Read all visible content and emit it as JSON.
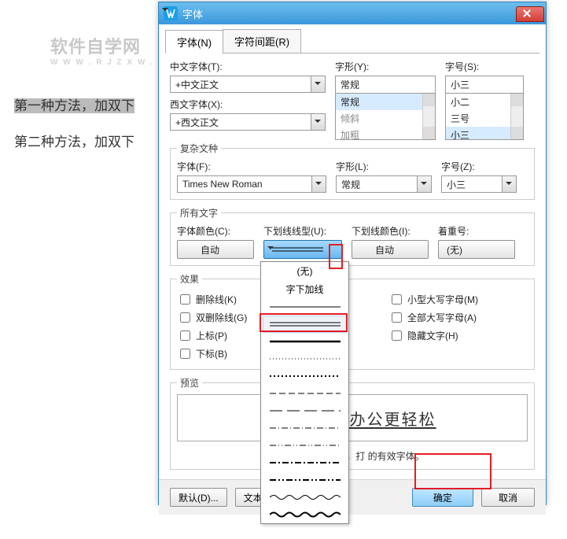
{
  "watermark": {
    "main": "软件自学网",
    "sub": "W W W . R J Z X W . C O M"
  },
  "bg": {
    "l1": "第一种方法，加双下",
    "l2": "第二种方法，加双下"
  },
  "dialog": {
    "title": "字体",
    "tabs": {
      "font": "字体(N)",
      "spacing": "字符间距(R)"
    },
    "cnFontLabel": "中文字体(T):",
    "cnFont": "+中文正文",
    "styleLabel": "字形(Y):",
    "style": "常规",
    "styles": {
      "a": "常规",
      "b": "倾斜",
      "c": "加粗"
    },
    "sizeLabel": "字号(S):",
    "size": "小三",
    "sizes": {
      "a": "小二",
      "b": "三号",
      "c": "小三"
    },
    "enFontLabel": "西文字体(X):",
    "enFont": "+西文正文",
    "complex": {
      "legend": "复杂文种",
      "fontLabel": "字体(F):",
      "font": "Times New Roman",
      "styleLabel": "字形(L):",
      "style": "常规",
      "sizeLabel": "字号(Z):",
      "size": "小三"
    },
    "all": {
      "legend": "所有文字",
      "colorLabel": "字体颜色(C):",
      "color": "自动",
      "ulTypeLabel": "下划线线型(U):",
      "ulColorLabel": "下划线颜色(I):",
      "ulColor": "自动",
      "emphLabel": "着重号:",
      "emph": "(无)"
    },
    "effects": {
      "legend": "效果",
      "strike": "删除线(K)",
      "dstrike": "双删除线(G)",
      "sup": "上标(P)",
      "sub": "下标(B)",
      "smcaps": "小型大写字母(M)",
      "allcaps": "全部大写字母(A)",
      "hidden": "隐藏文字(H)"
    },
    "preview": {
      "label": "预览",
      "text": "比办公更轻松"
    },
    "note": "尚未安装此字体，打                              的有效字体。",
    "buttons": {
      "default": "默认(D)...",
      "textfx": "文本效",
      "ok": "确定",
      "cancel": "取消"
    },
    "dd": {
      "none": "(无)",
      "hdr": "字下加线"
    }
  }
}
